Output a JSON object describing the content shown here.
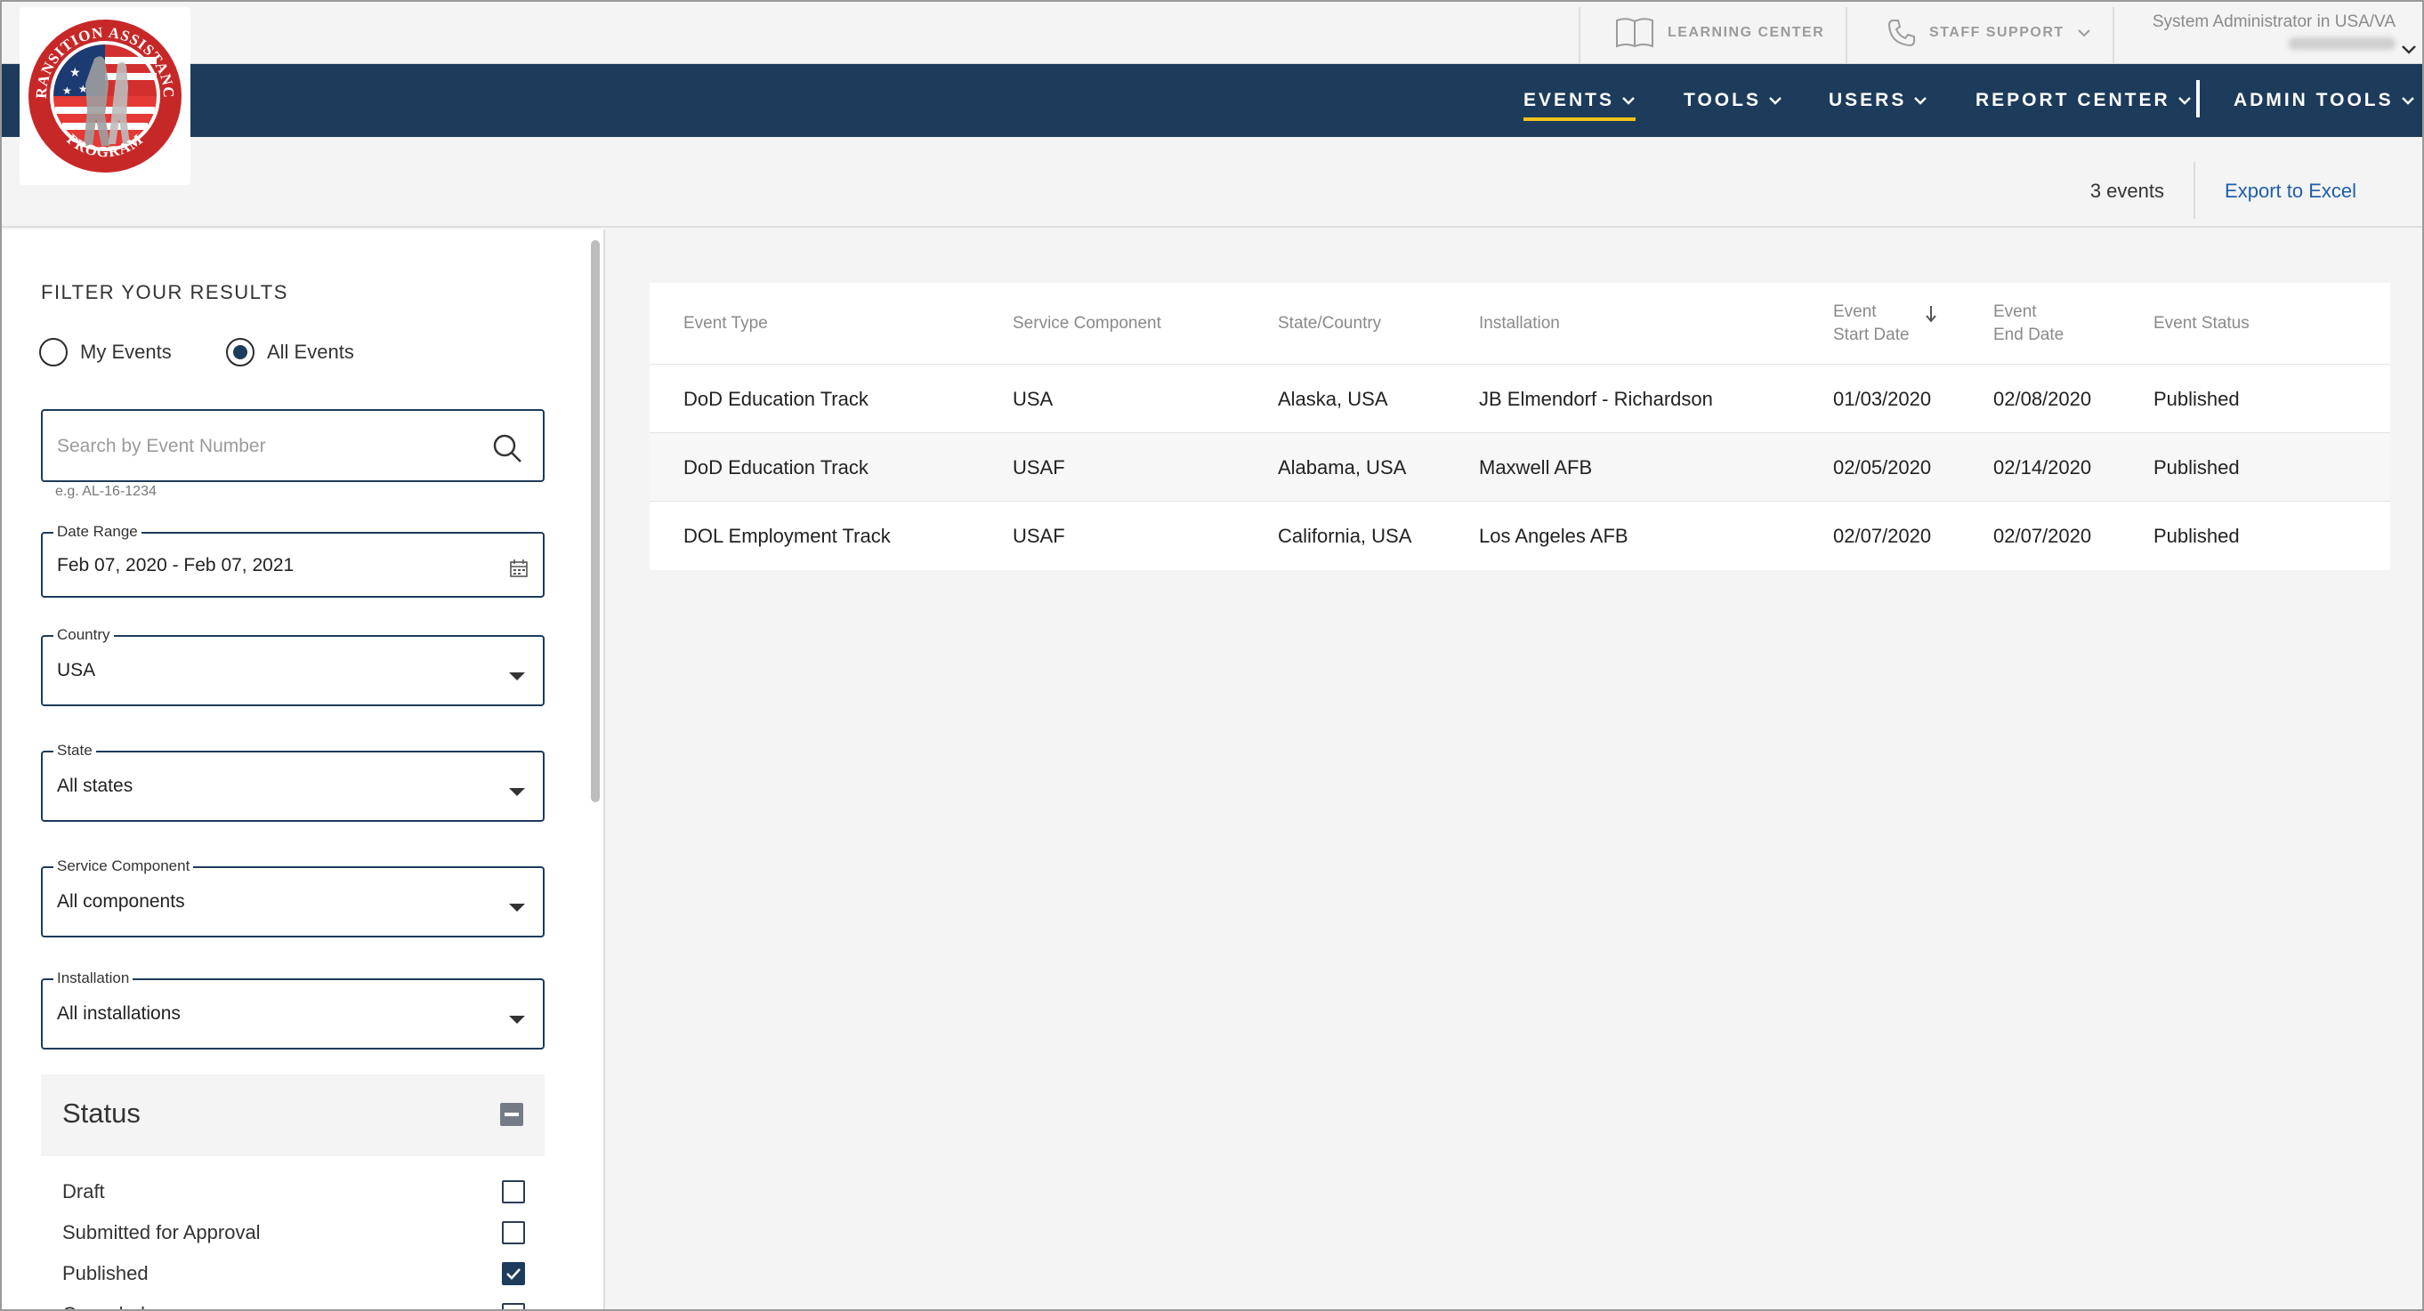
{
  "utility": {
    "learning_center": "LEARNING CENTER",
    "staff_support": "STAFF SUPPORT",
    "user_role": "System Administrator in USA/VA"
  },
  "logo": {
    "text_top": "TRANSITION ASSISTANCE",
    "text_bottom": "PROGRAM"
  },
  "nav": {
    "items": [
      {
        "label": "EVENTS",
        "active": true
      },
      {
        "label": "TOOLS"
      },
      {
        "label": "USERS"
      },
      {
        "label": "REPORT CENTER"
      },
      {
        "label": "ADMIN TOOLS"
      }
    ]
  },
  "results": {
    "count": "3 events",
    "export": "Export to Excel"
  },
  "sidebar": {
    "title": "FILTER YOUR RESULTS",
    "radio": {
      "my_events": "My Events",
      "all_events": "All Events",
      "selected": "All Events"
    },
    "search": {
      "placeholder": "Search by Event Number",
      "hint": "e.g. AL-16-1234"
    },
    "date_range": {
      "label": "Date Range",
      "value": "Feb 07, 2020 - Feb 07, 2021"
    },
    "country": {
      "label": "Country",
      "value": "USA"
    },
    "state": {
      "label": "State",
      "value": "All states"
    },
    "service_component": {
      "label": "Service Component",
      "value": "All components"
    },
    "installation": {
      "label": "Installation",
      "value": "All installations"
    },
    "status": {
      "title": "Status",
      "options": [
        {
          "label": "Draft",
          "checked": false
        },
        {
          "label": "Submitted for Approval",
          "checked": false
        },
        {
          "label": "Published",
          "checked": true
        },
        {
          "label": "Canceled",
          "checked": false
        }
      ]
    }
  },
  "table": {
    "headers": {
      "event_type": "Event Type",
      "service_component": "Service Component",
      "state_country": "State/Country",
      "installation": "Installation",
      "start_date_l1": "Event",
      "start_date_l2": "Start Date",
      "end_date_l1": "Event",
      "end_date_l2": "End Date",
      "status": "Event Status"
    },
    "rows": [
      {
        "event_type": "DoD Education Track",
        "service_component": "USA",
        "state_country": "Alaska, USA",
        "installation": "JB Elmendorf - Richardson",
        "start": "01/03/2020",
        "end": "02/08/2020",
        "status": "Published"
      },
      {
        "event_type": "DoD Education Track",
        "service_component": "USAF",
        "state_country": "Alabama, USA",
        "installation": "Maxwell AFB",
        "start": "02/05/2020",
        "end": "02/14/2020",
        "status": "Published"
      },
      {
        "event_type": "DOL Employment Track",
        "service_component": "USAF",
        "state_country": "California, USA",
        "installation": "Los Angeles AFB",
        "start": "02/07/2020",
        "end": "02/07/2020",
        "status": "Published"
      }
    ]
  },
  "colors": {
    "nav_bg": "#1d3b5b",
    "active_underline": "#f0c419",
    "link": "#1f5ea8"
  }
}
